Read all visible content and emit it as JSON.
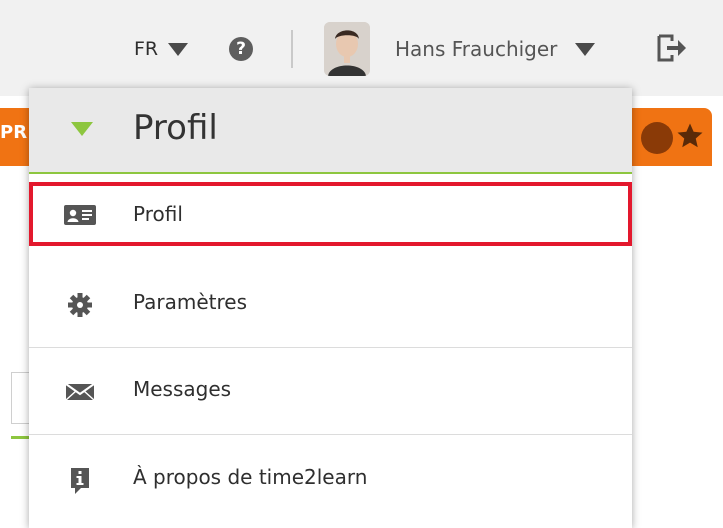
{
  "header": {
    "language": "FR",
    "user_name": "Hans Frauchiger"
  },
  "background": {
    "strip_label": "PR"
  },
  "dropdown": {
    "title": "Profil",
    "items": [
      {
        "label": "Profil",
        "icon": "id-card-icon"
      },
      {
        "label": "Paramètres",
        "icon": "gear-icon"
      },
      {
        "label": "Messages",
        "icon": "envelope-icon"
      },
      {
        "label": "À propos de time2learn",
        "icon": "info-bubble-icon"
      }
    ]
  },
  "colors": {
    "accent_green": "#8dc63f",
    "orange": "#f07313",
    "selection_red": "#e3182d"
  }
}
